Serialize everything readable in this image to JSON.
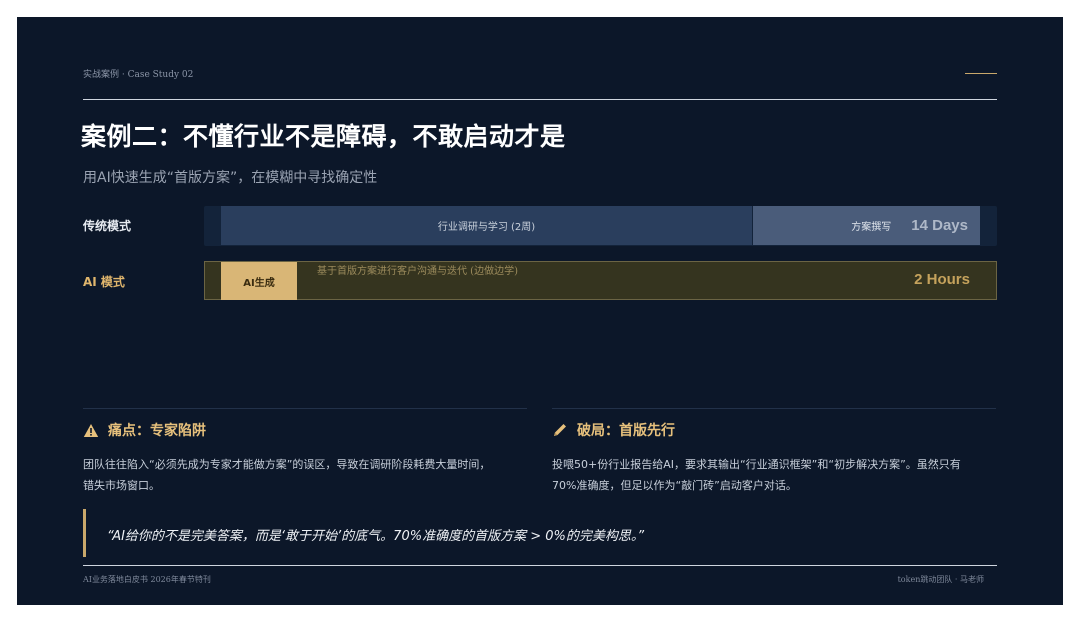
{
  "header": {
    "kicker": "实战案例 · Case Study 02",
    "title": "案例二：不懂行业不是障碍，不敢启动才是",
    "subtitle": "用AI快速生成“首版方案”，在模糊中寻找确定性"
  },
  "comparison": {
    "traditional": {
      "label": "传统模式",
      "research_label": "行业调研与学习 (2周)",
      "writing_label": "方案撰写",
      "duration": "14 Days"
    },
    "ai": {
      "label": "AI 模式",
      "generate_label": "AI生成",
      "iterate_label": "基于首版方案进行客户沟通与迭代 (边做边学)",
      "duration": "2 Hours"
    }
  },
  "cards": {
    "pain": {
      "icon": "warning-icon",
      "title": "痛点：专家陷阱",
      "line1": "团队往往陷入“必须先成为专家才能做方案”的误区，导致在调研阶段耗费大量时间，",
      "line2": "错失市场窗口。"
    },
    "breakthrough": {
      "icon": "pencil-icon",
      "title": "破局：首版先行",
      "line1": "投喂50+份行业报告给AI，要求其输出“行业通识框架”和“初步解决方案”。虽然只有",
      "line2": "70%准确度，但足以作为“敲门砖”启动客户对话。"
    }
  },
  "quote": "“AI给你的不是完美答案，而是‘敢于开始’的底气。70%准确度的首版方案 > 0%的完美构思。”",
  "footer": {
    "left": "AI业务落地白皮书 2026年春节特刊",
    "right": "token跳动团队 · 马老师"
  },
  "colors": {
    "background": "#0c1729",
    "accent_gold": "#c9a86b",
    "research_bar": "#2a3e5d",
    "writing_bar": "#4a5c7a"
  }
}
